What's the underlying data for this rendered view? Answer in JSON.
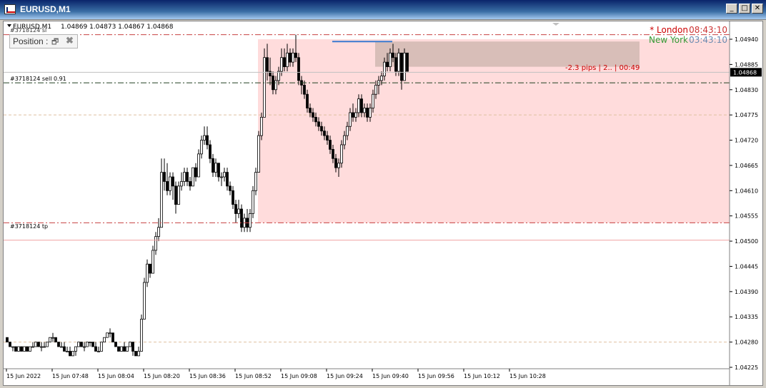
{
  "window": {
    "title": "EURUSD,M1",
    "buttons": [
      "_",
      "□",
      "✕"
    ]
  },
  "chart_header": {
    "symbol": "EURUSD,M1",
    "ohlc": "1.04869 1.04873 1.04867 1.04868"
  },
  "position_panel": {
    "label": "Position :",
    "restore_icon": "restore-icon",
    "close_icon": "close-icon"
  },
  "sessions": [
    {
      "marker": "* London",
      "time": "08:43:10",
      "name_color": "#cc0000",
      "time_color": "#cc3333"
    },
    {
      "marker": "New York",
      "time": "03:43:10",
      "name_color": "#339933",
      "time_color": "#6a8ab0"
    }
  ],
  "trade_labels": {
    "sell": "#3718124 sell 0.91",
    "tp": "#3718124 tp",
    "info": "-2.3 pips | 2.. | 00:49",
    "top_cut": "#3718124 sl"
  },
  "price_axis": {
    "labels": [
      "1.04940",
      "1.04885",
      "1.04830",
      "1.04775",
      "1.04720",
      "1.04665",
      "1.04610",
      "1.04555",
      "1.04500",
      "1.04445",
      "1.04390",
      "1.04335",
      "1.04280",
      "1.04225"
    ],
    "current": "1.04868"
  },
  "time_axis": {
    "labels": [
      "15 Jun 2022",
      "15 Jun 07:48",
      "15 Jun 08:04",
      "15 Jun 08:20",
      "15 Jun 08:36",
      "15 Jun 08:52",
      "15 Jun 09:08",
      "15 Jun 09:24",
      "15 Jun 09:40",
      "15 Jun 09:56",
      "15 Jun 10:12",
      "15 Jun 10:28"
    ]
  },
  "colors": {
    "zone": "#ffdcdc",
    "zone_dark": "#d8beb8",
    "sl_line": "#c84040",
    "entry_line": "#204020",
    "grid": "#e0c0a0",
    "blue_line": "#3a7ad0"
  },
  "chart_data": {
    "type": "candlestick",
    "ylim": [
      1.04212,
      1.04964
    ],
    "candles": [
      [
        1.0429,
        1.0429,
        1.0428,
        1.0428
      ],
      [
        1.0428,
        1.0428,
        1.0427,
        1.0427
      ],
      [
        1.0427,
        1.0427,
        1.0426,
        1.0427
      ],
      [
        1.0427,
        1.0427,
        1.0426,
        1.0426
      ],
      [
        1.0426,
        1.0427,
        1.0426,
        1.0427
      ],
      [
        1.0427,
        1.0427,
        1.0426,
        1.0426
      ],
      [
        1.0426,
        1.0427,
        1.0426,
        1.0427
      ],
      [
        1.0427,
        1.0427,
        1.0426,
        1.0426
      ],
      [
        1.0426,
        1.0427,
        1.0426,
        1.0427
      ],
      [
        1.0427,
        1.0428,
        1.0427,
        1.0427
      ],
      [
        1.0427,
        1.0428,
        1.0427,
        1.0428
      ],
      [
        1.0428,
        1.0428,
        1.0427,
        1.0427
      ],
      [
        1.0427,
        1.0428,
        1.0426,
        1.0427
      ],
      [
        1.0427,
        1.0428,
        1.0427,
        1.0427
      ],
      [
        1.0427,
        1.0428,
        1.0427,
        1.0428
      ],
      [
        1.0428,
        1.0429,
        1.0428,
        1.0429
      ],
      [
        1.0429,
        1.043,
        1.0428,
        1.0429
      ],
      [
        1.0429,
        1.0429,
        1.0428,
        1.0428
      ],
      [
        1.0428,
        1.0428,
        1.0427,
        1.0427
      ],
      [
        1.0427,
        1.0428,
        1.0427,
        1.0427
      ],
      [
        1.0427,
        1.0428,
        1.0426,
        1.0426
      ],
      [
        1.0426,
        1.0427,
        1.0426,
        1.0426
      ],
      [
        1.0426,
        1.0427,
        1.0425,
        1.0425
      ],
      [
        1.0425,
        1.0426,
        1.0425,
        1.0426
      ],
      [
        1.0426,
        1.0427,
        1.0425,
        1.0427
      ],
      [
        1.0427,
        1.0428,
        1.0427,
        1.0428
      ],
      [
        1.0428,
        1.0428,
        1.0427,
        1.0427
      ],
      [
        1.0427,
        1.0428,
        1.0426,
        1.0427
      ],
      [
        1.0427,
        1.0428,
        1.0427,
        1.0428
      ],
      [
        1.0428,
        1.0428,
        1.0427,
        1.0428
      ],
      [
        1.0428,
        1.0428,
        1.0427,
        1.0427
      ],
      [
        1.0427,
        1.0428,
        1.0426,
        1.0426
      ],
      [
        1.0426,
        1.0427,
        1.0426,
        1.0426
      ],
      [
        1.0426,
        1.0428,
        1.0426,
        1.0428
      ],
      [
        1.0428,
        1.0429,
        1.0428,
        1.0429
      ],
      [
        1.0429,
        1.043,
        1.0429,
        1.043
      ],
      [
        1.043,
        1.0431,
        1.0429,
        1.043
      ],
      [
        1.043,
        1.043,
        1.0428,
        1.0428
      ],
      [
        1.0428,
        1.0428,
        1.0427,
        1.0427
      ],
      [
        1.0427,
        1.0427,
        1.0426,
        1.0426
      ],
      [
        1.0426,
        1.0427,
        1.0426,
        1.0427
      ],
      [
        1.0427,
        1.0428,
        1.0426,
        1.0426
      ],
      [
        1.0426,
        1.0427,
        1.0426,
        1.0427
      ],
      [
        1.0427,
        1.0428,
        1.0427,
        1.0428
      ],
      [
        1.0428,
        1.0428,
        1.0425,
        1.0426
      ],
      [
        1.0426,
        1.0426,
        1.0425,
        1.0425
      ],
      [
        1.0425,
        1.0427,
        1.0425,
        1.0426
      ],
      [
        1.0426,
        1.0434,
        1.0426,
        1.0433
      ],
      [
        1.0433,
        1.0442,
        1.0433,
        1.0441
      ],
      [
        1.0441,
        1.0446,
        1.044,
        1.0445
      ],
      [
        1.0445,
        1.0445,
        1.0442,
        1.0443
      ],
      [
        1.0443,
        1.0449,
        1.0443,
        1.0448
      ],
      [
        1.0448,
        1.0452,
        1.0447,
        1.0451
      ],
      [
        1.0451,
        1.0455,
        1.045,
        1.0453
      ],
      [
        1.0453,
        1.0468,
        1.0453,
        1.0465
      ],
      [
        1.0465,
        1.0468,
        1.0461,
        1.0463
      ],
      [
        1.0463,
        1.0467,
        1.046,
        1.0461
      ],
      [
        1.0461,
        1.0465,
        1.046,
        1.0464
      ],
      [
        1.0464,
        1.0465,
        1.0459,
        1.0462
      ],
      [
        1.0462,
        1.0463,
        1.0456,
        1.0458
      ],
      [
        1.0458,
        1.0463,
        1.0458,
        1.0462
      ],
      [
        1.0462,
        1.0465,
        1.0461,
        1.0463
      ],
      [
        1.0463,
        1.0466,
        1.0462,
        1.0465
      ],
      [
        1.0465,
        1.0466,
        1.0462,
        1.0463
      ],
      [
        1.0463,
        1.0464,
        1.0461,
        1.0462
      ],
      [
        1.0462,
        1.0466,
        1.0462,
        1.0466
      ],
      [
        1.0466,
        1.0467,
        1.0463,
        1.0464
      ],
      [
        1.0464,
        1.047,
        1.0464,
        1.0469
      ],
      [
        1.0469,
        1.0473,
        1.0468,
        1.0472
      ],
      [
        1.0472,
        1.0475,
        1.0471,
        1.0473
      ],
      [
        1.0473,
        1.0475,
        1.047,
        1.0471
      ],
      [
        1.0471,
        1.0472,
        1.0467,
        1.0468
      ],
      [
        1.0468,
        1.0469,
        1.0464,
        1.0465
      ],
      [
        1.0465,
        1.0468,
        1.0464,
        1.0467
      ],
      [
        1.0467,
        1.0467,
        1.0463,
        1.0464
      ],
      [
        1.0464,
        1.0465,
        1.0462,
        1.0464
      ],
      [
        1.0464,
        1.0466,
        1.0463,
        1.0465
      ],
      [
        1.0465,
        1.0466,
        1.0461,
        1.0462
      ],
      [
        1.0462,
        1.0463,
        1.046,
        1.0461
      ],
      [
        1.0461,
        1.0462,
        1.0457,
        1.0458
      ],
      [
        1.0458,
        1.0459,
        1.0454,
        1.0456
      ],
      [
        1.0456,
        1.0459,
        1.0455,
        1.0457
      ],
      [
        1.0457,
        1.0458,
        1.0452,
        1.0453
      ],
      [
        1.0453,
        1.0456,
        1.0452,
        1.0455
      ],
      [
        1.0455,
        1.0457,
        1.0452,
        1.0453
      ],
      [
        1.0453,
        1.0457,
        1.0452,
        1.0456
      ],
      [
        1.0456,
        1.0462,
        1.0455,
        1.0461
      ],
      [
        1.0461,
        1.0466,
        1.046,
        1.0465
      ],
      [
        1.0465,
        1.0474,
        1.0465,
        1.0473
      ],
      [
        1.0473,
        1.0478,
        1.0472,
        1.0477
      ],
      [
        1.0477,
        1.0492,
        1.0477,
        1.049
      ],
      [
        1.049,
        1.0493,
        1.0485,
        1.0487
      ],
      [
        1.0487,
        1.049,
        1.0484,
        1.0486
      ],
      [
        1.0486,
        1.0487,
        1.0482,
        1.0483
      ],
      [
        1.0483,
        1.0486,
        1.0482,
        1.0485
      ],
      [
        1.0485,
        1.0488,
        1.0484,
        1.0487
      ],
      [
        1.0487,
        1.0492,
        1.0486,
        1.049
      ],
      [
        1.049,
        1.0492,
        1.0487,
        1.0488
      ],
      [
        1.0488,
        1.0493,
        1.0487,
        1.0491
      ],
      [
        1.0491,
        1.0492,
        1.0488,
        1.0489
      ],
      [
        1.0489,
        1.0492,
        1.0488,
        1.0491
      ],
      [
        1.0491,
        1.0495,
        1.0489,
        1.049
      ],
      [
        1.049,
        1.0491,
        1.0484,
        1.0485
      ],
      [
        1.0485,
        1.0486,
        1.0482,
        1.0484
      ],
      [
        1.0484,
        1.0485,
        1.0481,
        1.0482
      ],
      [
        1.0482,
        1.0483,
        1.0478,
        1.0479
      ],
      [
        1.0479,
        1.048,
        1.0477,
        1.0478
      ],
      [
        1.0478,
        1.0479,
        1.0476,
        1.0477
      ],
      [
        1.0477,
        1.0478,
        1.0475,
        1.0476
      ],
      [
        1.0476,
        1.0477,
        1.0474,
        1.0475
      ],
      [
        1.0475,
        1.0476,
        1.0473,
        1.0474
      ],
      [
        1.0474,
        1.0475,
        1.0472,
        1.0473
      ],
      [
        1.0473,
        1.0474,
        1.0471,
        1.0472
      ],
      [
        1.0472,
        1.0473,
        1.0469,
        1.047
      ],
      [
        1.047,
        1.0471,
        1.0467,
        1.0468
      ],
      [
        1.0468,
        1.0469,
        1.0465,
        1.0466
      ],
      [
        1.0466,
        1.0468,
        1.0464,
        1.0467
      ],
      [
        1.0467,
        1.0472,
        1.0466,
        1.0471
      ],
      [
        1.0471,
        1.0474,
        1.047,
        1.0473
      ],
      [
        1.0473,
        1.0476,
        1.0472,
        1.0475
      ],
      [
        1.0475,
        1.0479,
        1.0474,
        1.0478
      ],
      [
        1.0478,
        1.048,
        1.0476,
        1.0477
      ],
      [
        1.0477,
        1.0479,
        1.0476,
        1.0478
      ],
      [
        1.0478,
        1.0482,
        1.0477,
        1.0481
      ],
      [
        1.0481,
        1.0482,
        1.0477,
        1.0478
      ],
      [
        1.0478,
        1.048,
        1.0477,
        1.0479
      ],
      [
        1.0479,
        1.048,
        1.0476,
        1.0477
      ],
      [
        1.0477,
        1.048,
        1.0476,
        1.0479
      ],
      [
        1.0479,
        1.0483,
        1.0478,
        1.0482
      ],
      [
        1.0482,
        1.0485,
        1.0481,
        1.0484
      ],
      [
        1.0484,
        1.0486,
        1.0482,
        1.0485
      ],
      [
        1.0485,
        1.0487,
        1.0484,
        1.0486
      ],
      [
        1.0486,
        1.049,
        1.0485,
        1.0489
      ],
      [
        1.0489,
        1.0491,
        1.0487,
        1.0488
      ],
      [
        1.0488,
        1.0492,
        1.0487,
        1.0491
      ],
      [
        1.0491,
        1.0493,
        1.0489,
        1.049
      ],
      [
        1.049,
        1.0491,
        1.0486,
        1.0487
      ],
      [
        1.0487,
        1.0492,
        1.0486,
        1.0491
      ],
      [
        1.0491,
        1.0491,
        1.0483,
        1.0485
      ],
      [
        1.0485,
        1.0492,
        1.0485,
        1.0491
      ],
      [
        1.0491,
        1.0491,
        1.0487,
        1.0487
      ]
    ],
    "zone_y": [
      1.0494,
      1.0454
    ],
    "lines": {
      "sl": 1.0495,
      "entry": 1.04845,
      "tp": 1.0454,
      "current": 1.04868,
      "faint_red": 1.04502
    }
  }
}
